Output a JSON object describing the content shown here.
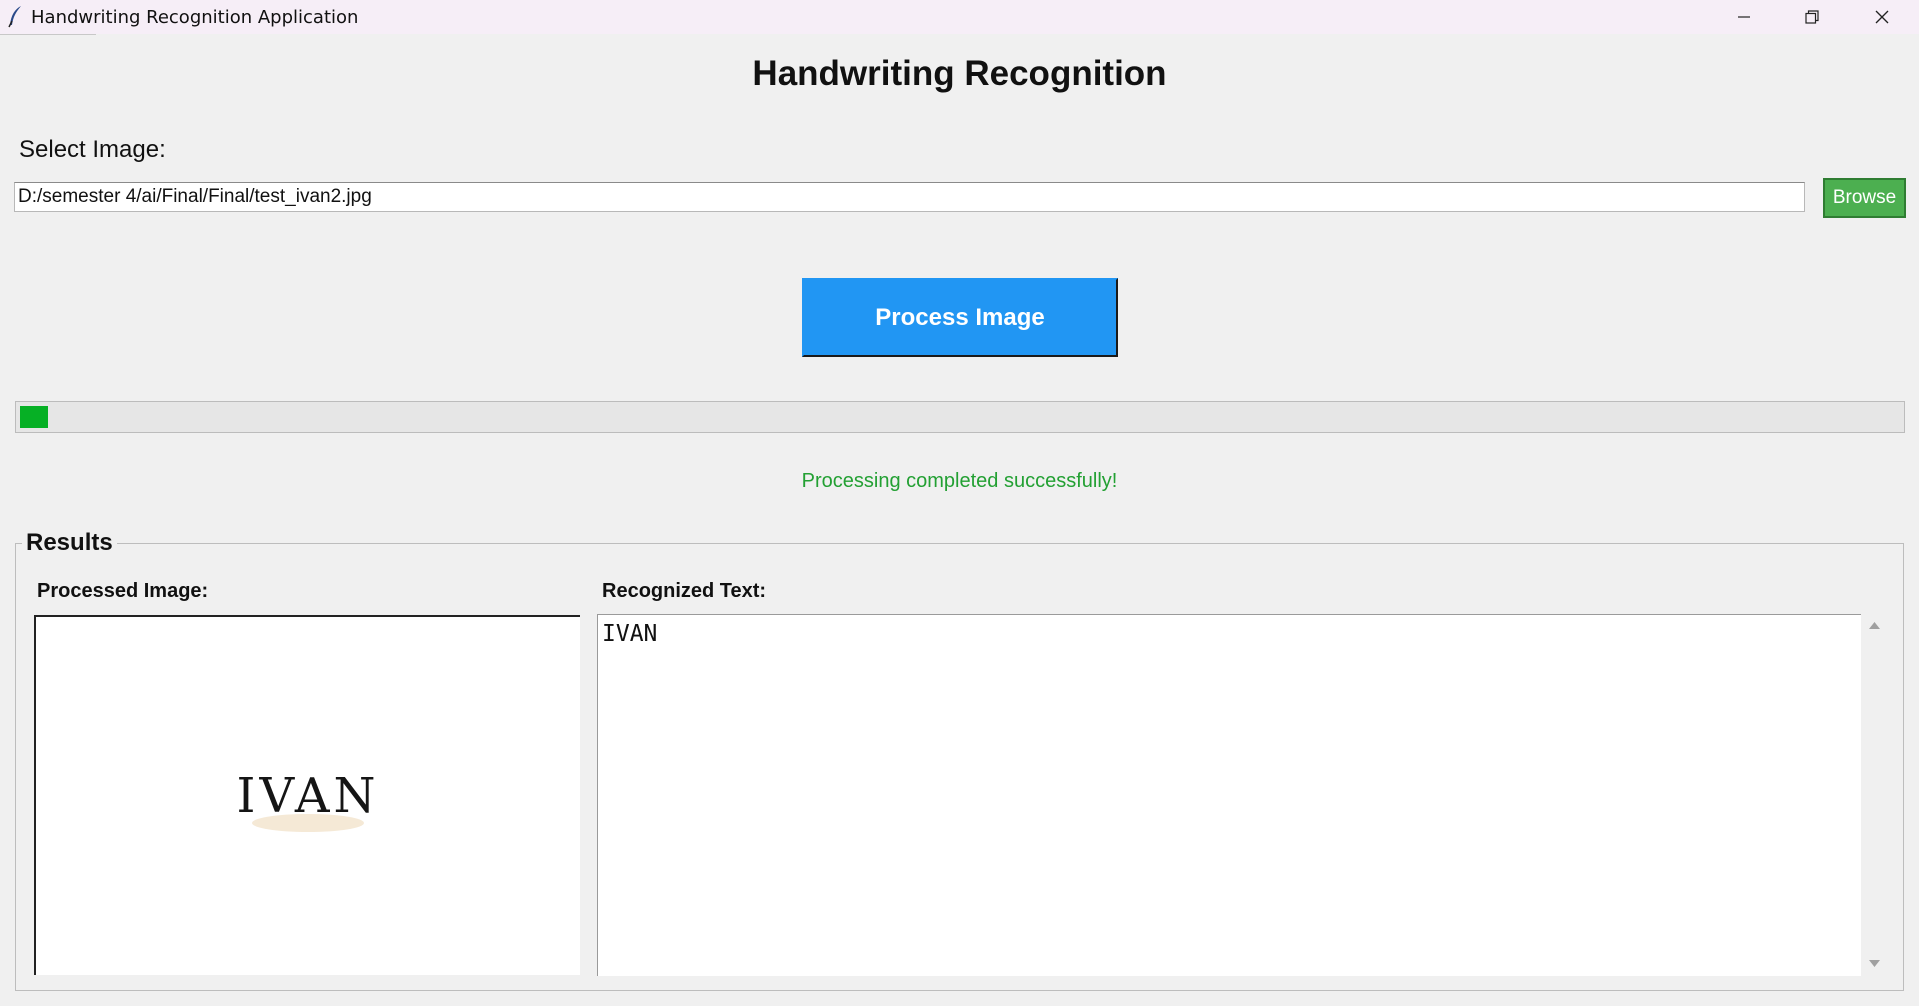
{
  "window": {
    "title": "Handwriting Recognition Application",
    "controls": [
      "minimize-icon",
      "restore-icon",
      "close-icon"
    ]
  },
  "app": {
    "title": "Handwriting Recognition",
    "select_label": "Select Image:",
    "file_path": "D:/semester 4/ai/Final/Final/test_ivan2.jpg",
    "browse_label": "Browse",
    "process_label": "Process Image",
    "progress_fraction": 0.015,
    "status": "Processing completed successfully!"
  },
  "results": {
    "title": "Results",
    "processed_image_label": "Processed Image:",
    "recognized_text_label": "Recognized Text:",
    "handwritten_text": "IVAN",
    "recognized_text": "IVAN"
  },
  "colors": {
    "browse_button": "#4caf50",
    "process_button": "#2196f3",
    "progress": "#06b025",
    "status": "#23a033"
  }
}
